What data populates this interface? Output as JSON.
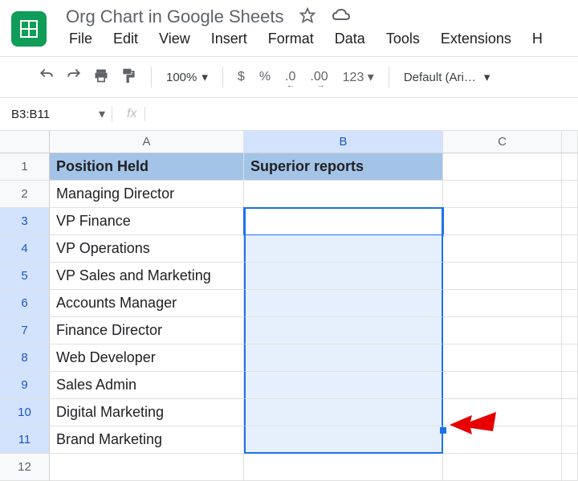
{
  "header": {
    "doc_title": "Org Chart in Google Sheets"
  },
  "menubar": [
    "File",
    "Edit",
    "View",
    "Insert",
    "Format",
    "Data",
    "Tools",
    "Extensions",
    "H"
  ],
  "toolbar": {
    "zoom": "100%",
    "currency": "$",
    "percent": "%",
    "dec_dec": ".0",
    "inc_dec": ".00",
    "numfmt": "123",
    "font": "Default (Ari…"
  },
  "namebox": "B3:B11",
  "fx": "fx",
  "columns": [
    "A",
    "B",
    "C"
  ],
  "rows": [
    "1",
    "2",
    "3",
    "4",
    "5",
    "6",
    "7",
    "8",
    "9",
    "10",
    "11",
    "12"
  ],
  "table": {
    "headers": {
      "A": "Position Held",
      "B": "Superior reports"
    },
    "colA": [
      "Managing Director",
      "VP Finance",
      "VP Operations",
      "VP Sales and Marketing",
      "Accounts Manager",
      "Finance Director",
      "Web Developer",
      "Sales Admin",
      "Digital Marketing",
      "Brand Marketing"
    ]
  },
  "selection": {
    "range": "B3:B11",
    "active": "B3"
  }
}
